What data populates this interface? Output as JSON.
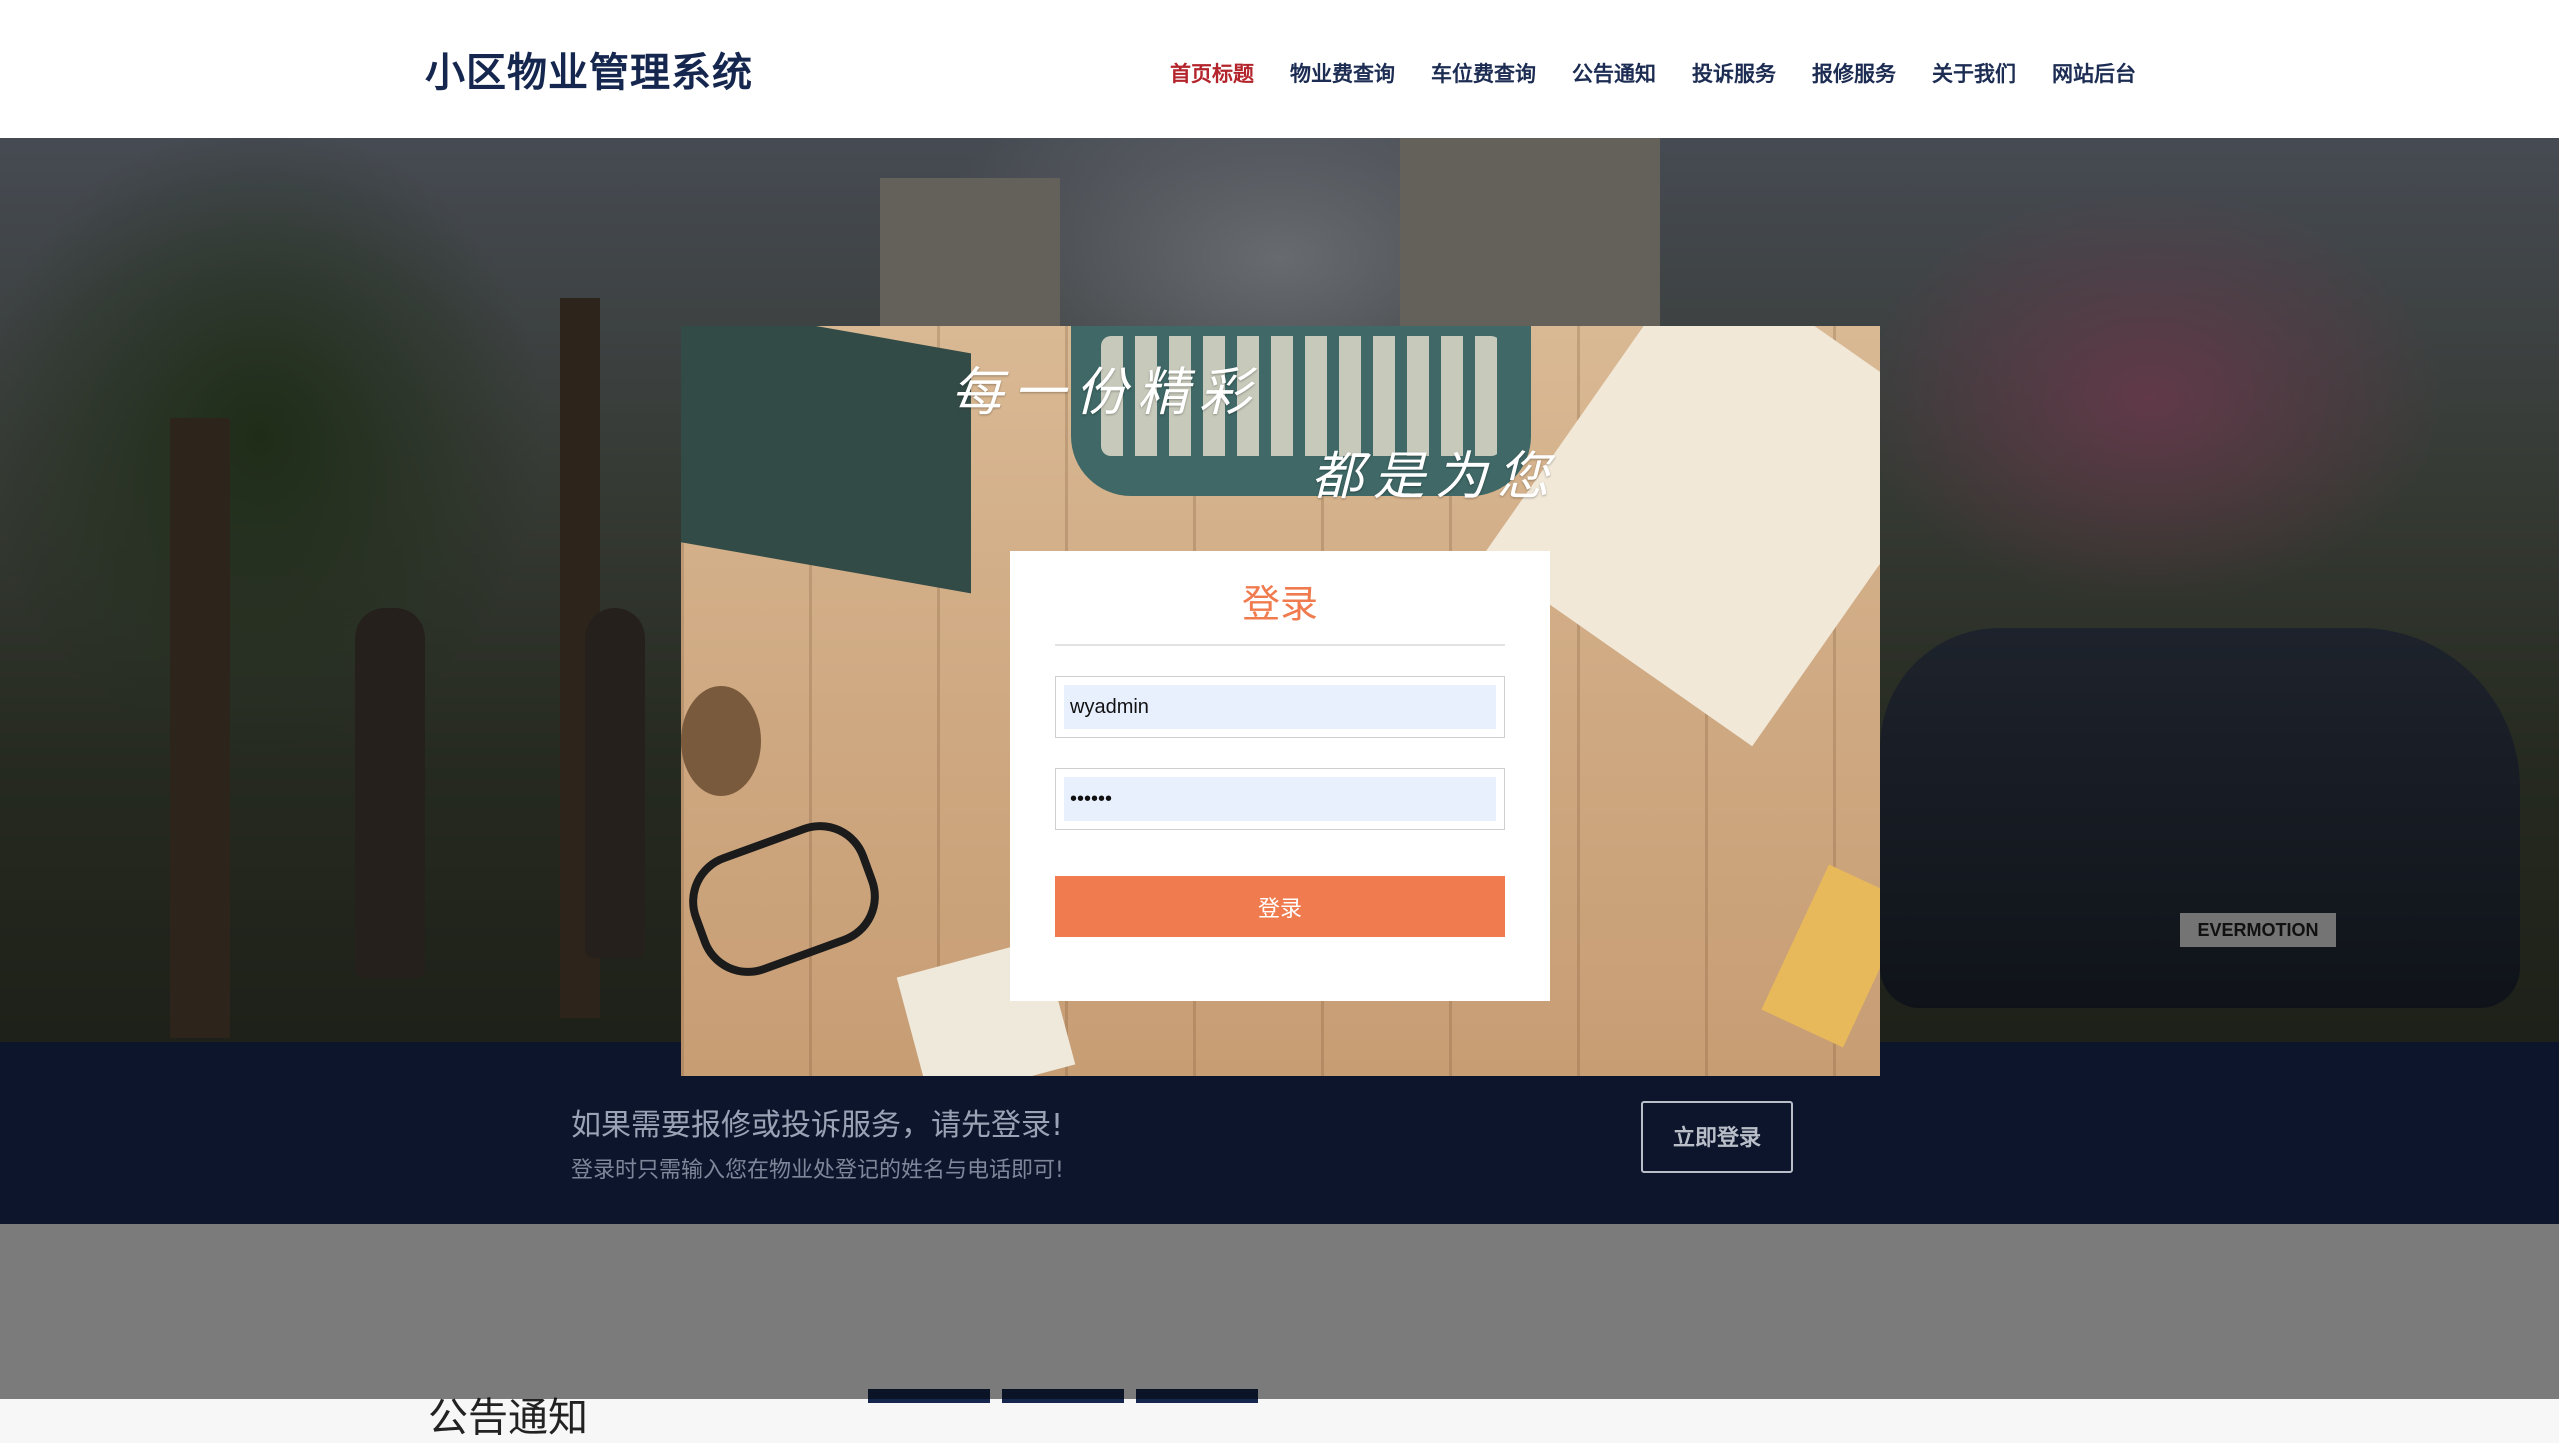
{
  "header": {
    "brand": "小区物业管理系统",
    "nav": [
      {
        "label": "首页标题",
        "active": true
      },
      {
        "label": "物业费查询"
      },
      {
        "label": "车位费查询"
      },
      {
        "label": "公告通知"
      },
      {
        "label": "投诉服务"
      },
      {
        "label": "报修服务"
      },
      {
        "label": "关于我们"
      },
      {
        "label": "网站后台"
      }
    ]
  },
  "hero": {
    "plate_text": "EVERMOTION"
  },
  "modal": {
    "handwriting_line1": "每一份精彩",
    "handwriting_line2": "都是为您",
    "login": {
      "title": "登录",
      "username_value": "wyadmin",
      "password_value": "••••••",
      "submit_label": "登录"
    }
  },
  "band": {
    "title": "如果需要报修或投诉服务，请先登录!",
    "subtitle": "登录时只需输入您在物业处登记的姓名与电话即可!",
    "button_label": "立即登录"
  },
  "lower": {
    "title": "公告通知"
  },
  "colors": {
    "brand_navy": "#16274f",
    "accent_orange": "#f07b4e",
    "active_nav_red": "#b3242c"
  }
}
